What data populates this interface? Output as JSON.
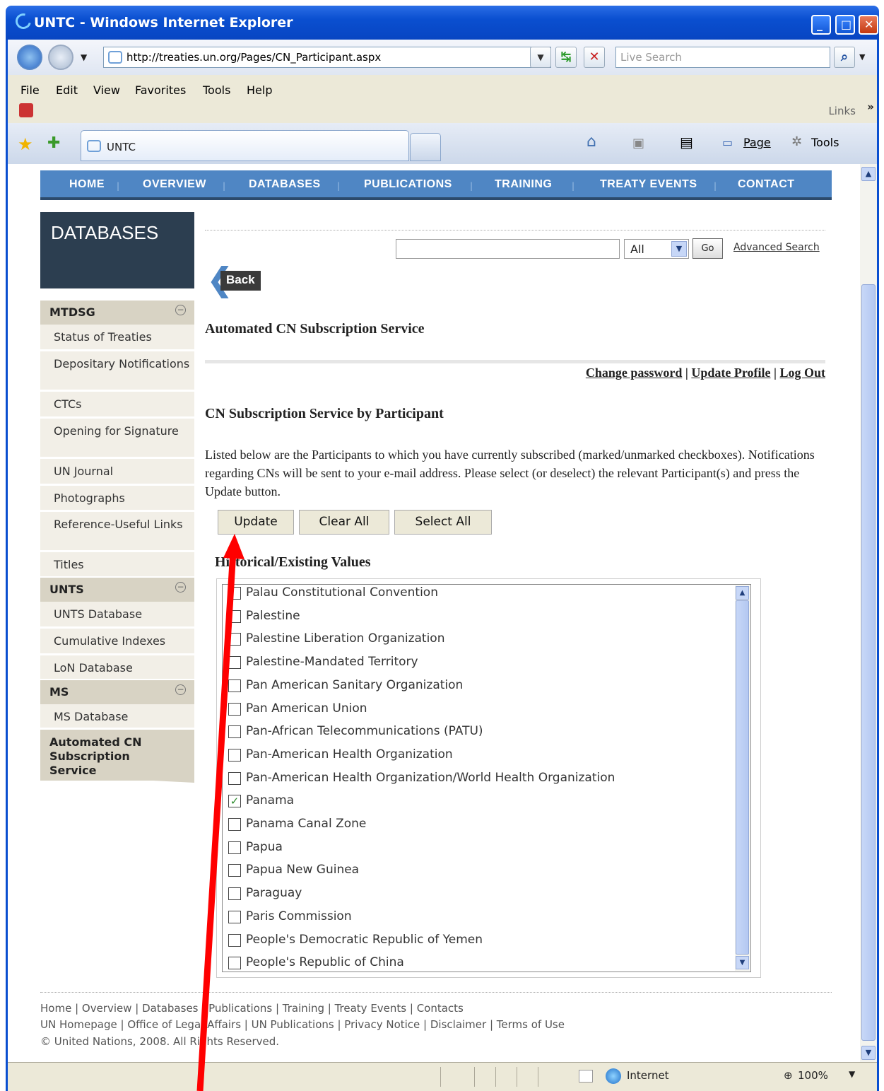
{
  "window": {
    "title": "UNTC - Windows Internet Explorer"
  },
  "address": {
    "url": "http://treaties.un.org/Pages/CN_Participant.aspx",
    "search_placeholder": "Live Search"
  },
  "menu": [
    "File",
    "Edit",
    "View",
    "Favorites",
    "Tools",
    "Help"
  ],
  "links_label": "Links",
  "tab": {
    "label": "UNTC"
  },
  "toolbar": {
    "page": "Page",
    "tools": "Tools"
  },
  "sitenav": [
    "HOME",
    "OVERVIEW",
    "DATABASES",
    "PUBLICATIONS",
    "TRAINING",
    "TREATY EVENTS",
    "CONTACT"
  ],
  "sidebar": {
    "header": "DATABASES",
    "sections": [
      {
        "title": "MTDSG",
        "items": [
          "Status of Treaties",
          "Depositary Notifications",
          "CTCs",
          "Opening for Signature",
          "UN Journal",
          "Photographs",
          "Reference-Useful Links",
          "Titles"
        ]
      },
      {
        "title": "UNTS",
        "items": [
          "UNTS Database",
          "Cumulative Indexes",
          "LoN Database"
        ]
      },
      {
        "title": "MS",
        "items": [
          "MS Database"
        ]
      }
    ],
    "active": "Automated CN Subscription Service"
  },
  "search": {
    "select": "All",
    "go": "Go",
    "advanced": "Advanced Search"
  },
  "back": "Back",
  "main": {
    "title": "Automated CN Subscription Service",
    "account_links": [
      "Change password",
      "Update Profile",
      "Log Out"
    ],
    "subtitle": "CN Subscription Service by Participant",
    "description": "Listed below are the Participants to which you have currently subscribed (marked/unmarked checkboxes). Notifications regarding CNs will be sent to your e-mail address. Please select (or deselect) the relevant Participant(s) and press the Update button.",
    "buttons": {
      "update": "Update",
      "clear": "Clear All",
      "select": "Select All"
    },
    "list_title": "Historical/Existing Values",
    "participants": [
      {
        "name": "Palau Constitutional Convention",
        "checked": false
      },
      {
        "name": "Palestine",
        "checked": false
      },
      {
        "name": "Palestine Liberation Organization",
        "checked": false
      },
      {
        "name": "Palestine-Mandated Territory",
        "checked": false
      },
      {
        "name": "Pan American Sanitary Organization",
        "checked": false
      },
      {
        "name": "Pan American Union",
        "checked": false
      },
      {
        "name": "Pan-African Telecommunications (PATU)",
        "checked": false
      },
      {
        "name": "Pan-American Health Organization",
        "checked": false
      },
      {
        "name": "Pan-American Health Organization/World Health Organization",
        "checked": false
      },
      {
        "name": "Panama",
        "checked": true
      },
      {
        "name": "Panama Canal Zone",
        "checked": false
      },
      {
        "name": "Papua",
        "checked": false
      },
      {
        "name": "Papua New Guinea",
        "checked": false
      },
      {
        "name": "Paraguay",
        "checked": false
      },
      {
        "name": "Paris Commission",
        "checked": false
      },
      {
        "name": "People's Democratic Republic of Yemen",
        "checked": false
      },
      {
        "name": "People's Republic of China",
        "checked": false
      }
    ]
  },
  "footer": {
    "line1": "Home | Overview | Databases | Publications | Training | Treaty Events | Contacts",
    "line2": "UN Homepage | Office of Legal Affairs | UN Publications | Privacy Notice | Disclaimer | Terms of Use",
    "line3": "© United Nations, 2008. All Rights Reserved."
  },
  "status": {
    "zone": "Internet",
    "zoom": "100%"
  }
}
